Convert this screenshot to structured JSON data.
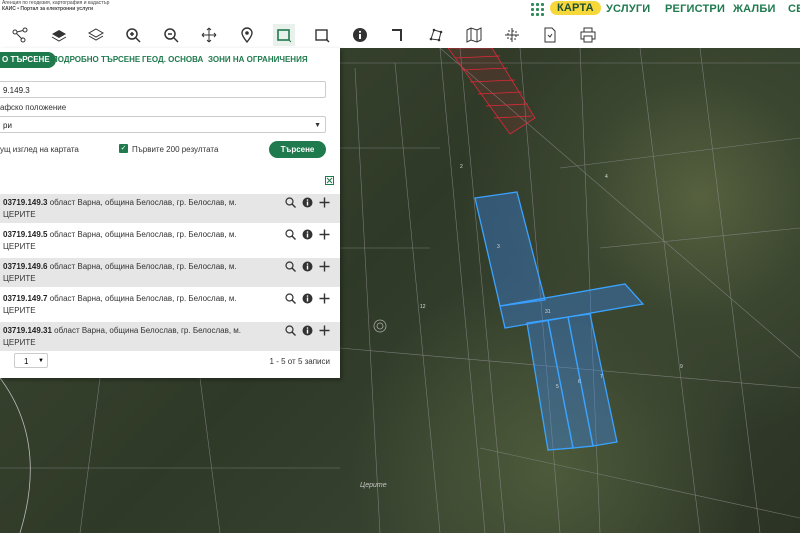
{
  "header": {
    "logo_lines": [
      "Агенция по геодезия, картография и кадастър",
      "КАИС • Портал за електронни услуги"
    ],
    "nav": [
      {
        "label": "КАРТА",
        "active": true
      },
      {
        "label": "УСЛУГИ"
      },
      {
        "label": "РЕГИСТРИ"
      },
      {
        "label": "ЖАЛБИ"
      },
      {
        "label": "СЕ"
      }
    ]
  },
  "toolbar": {
    "tools": [
      "connect-icon",
      "layers-icon",
      "layers-stack-icon",
      "zoom-in-icon",
      "zoom-out-icon",
      "pan-icon",
      "marker-icon",
      "select-rect-icon",
      "select-area-icon",
      "info-icon",
      "measure-icon",
      "polygon-icon",
      "map-icon",
      "crosshair-icon",
      "document-icon",
      "print-icon"
    ],
    "active_tool": "select-rect-icon"
  },
  "panel": {
    "tabs": [
      "О ТЪРСЕНЕ",
      "ПОДРОБНО ТЪРСЕНЕ",
      "ГЕОД. ОСНОВА",
      "ЗОНИ НА ОГРАНИЧЕНИЯ"
    ],
    "search_value": "9.149.3",
    "location_label": "афско положение",
    "location_value": "ри",
    "current_view_label": "ущ изглед на картата",
    "first200_label": "Първите 200 резултата",
    "search_button": "Търсене",
    "results": [
      {
        "id": "03719.149.3",
        "text": " област Варна, община Белослав, гр. Белослав, м.",
        "line2": "ЦЕРИТЕ"
      },
      {
        "id": "03719.149.5",
        "text": " област Варна, община Белослав, гр. Белослав, м.",
        "line2": "ЦЕРИТЕ"
      },
      {
        "id": "03719.149.6",
        "text": " област Варна, община Белослав, гр. Белослав, м.",
        "line2": "ЦЕРИТЕ"
      },
      {
        "id": "03719.149.7",
        "text": " област Варна, община Белослав, гр. Белослав, м.",
        "line2": "ЦЕРИТЕ"
      },
      {
        "id": "03719.149.31",
        "text": " област Варна, община Белослав, гр. Белослав, м.",
        "line2": "ЦЕРИТЕ"
      }
    ],
    "page": "1",
    "page_info": "1 - 5 от 5 записи"
  },
  "map": {
    "place_label": "Церите",
    "highlight_color": "#3aa3ff",
    "restriction_color": "#e0283a"
  }
}
